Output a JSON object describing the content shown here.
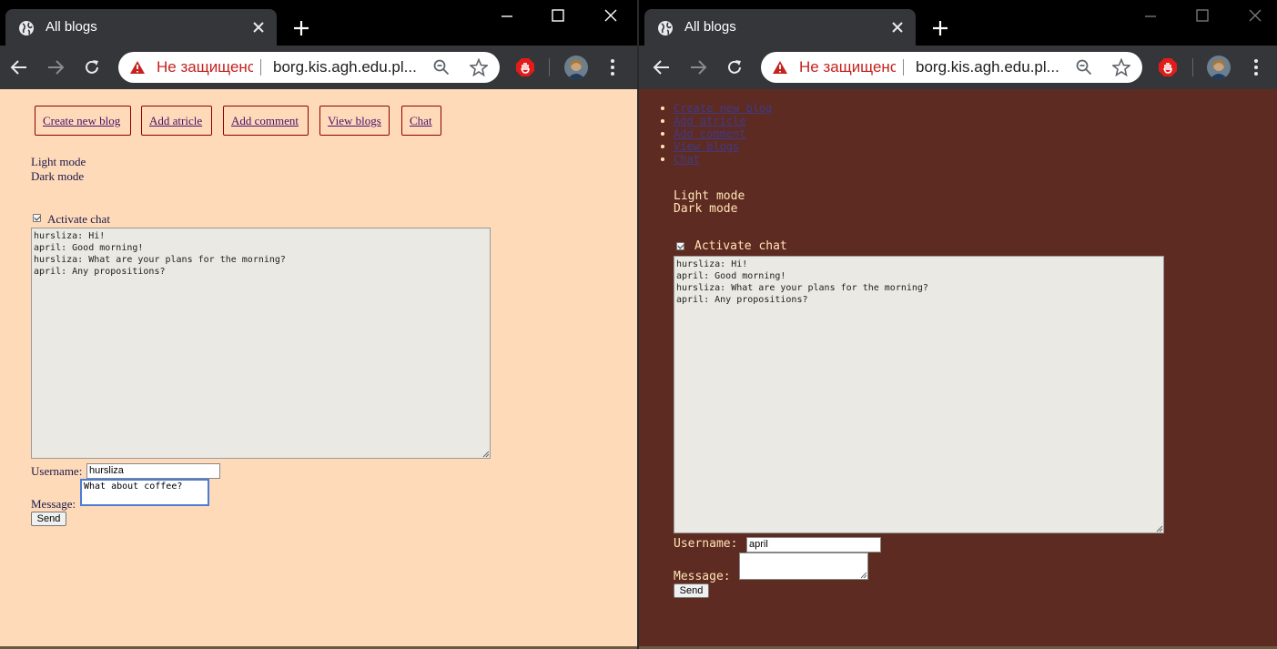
{
  "colors": {
    "light_page_bg": "#ffdab9",
    "dark_page_bg": "#5e2b22",
    "chrome_bar": "#35363a",
    "insecure_red": "#c5221f"
  },
  "browser": {
    "tab_title": "All blogs",
    "security_text": "Не защищенс",
    "url": "borg.kis.agh.edu.pl..."
  },
  "light_page": {
    "nav": [
      "Create new blog",
      "Add atricle",
      "Add comment",
      "View blogs",
      "Chat"
    ],
    "light_mode": "Light mode",
    "dark_mode": "Dark mode",
    "activate_chat": "Activate chat",
    "chat_log": "hursliza: Hi!\napril: Good morning!\nhursliza: What are your plans for the morning?\napril: Any propositions?",
    "username_label": "Username:",
    "username_value": "hursliza",
    "message_label": "Message:",
    "message_value": "What about coffee?",
    "send": "Send"
  },
  "dark_page": {
    "nav": [
      "Create new blog",
      "Add atricle",
      "Add comment",
      "View blogs",
      "Chat"
    ],
    "light_mode": "Light mode",
    "dark_mode": "Dark mode",
    "activate_chat": "Activate chat",
    "chat_log": "hursliza: Hi!\napril: Good morning!\nhursliza: What are your plans for the morning?\napril: Any propositions?",
    "username_label": "Username:",
    "username_value": "april",
    "message_label": "Message:",
    "message_value": "",
    "send": "Send"
  }
}
